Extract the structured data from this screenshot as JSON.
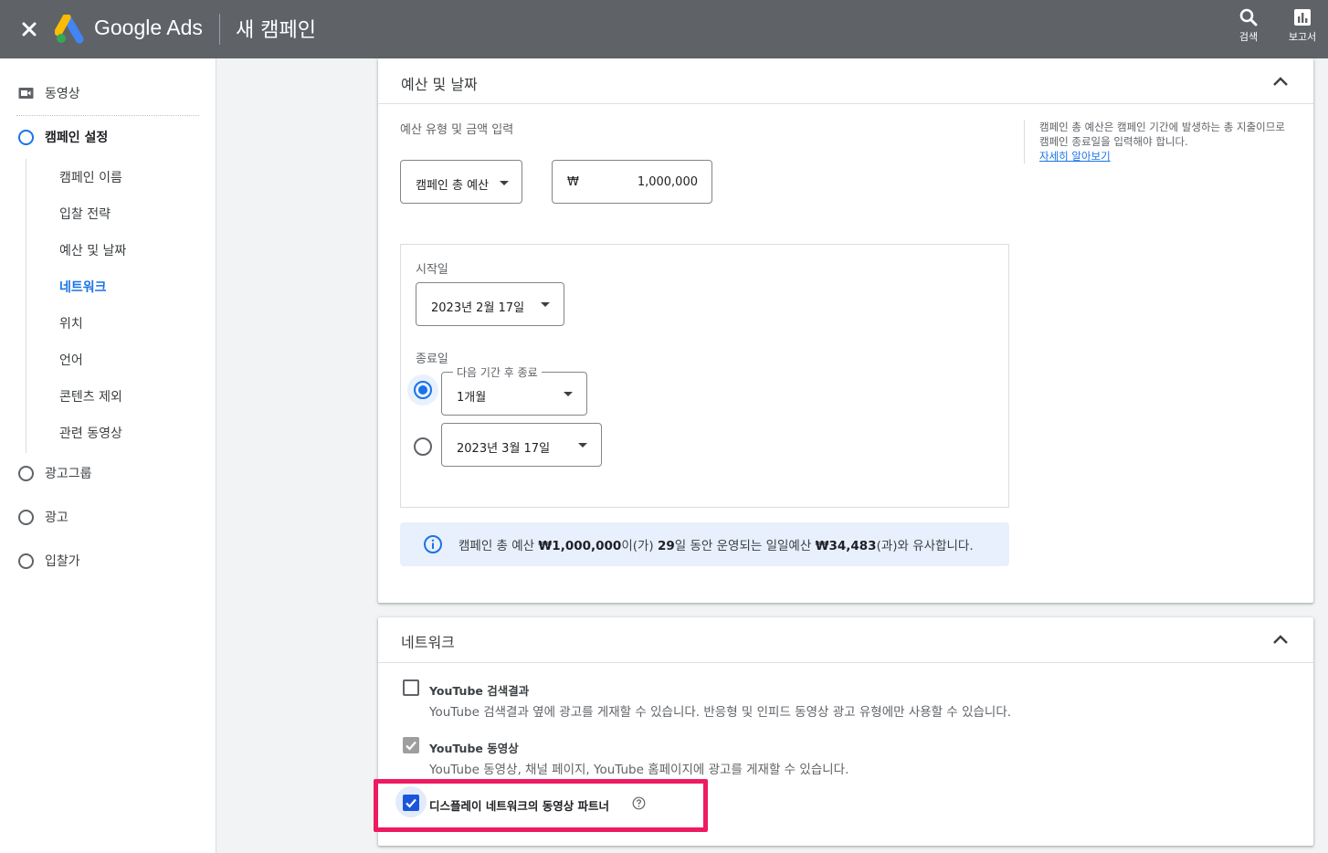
{
  "header": {
    "brand": "Google Ads",
    "title": "새 캠페인",
    "actions": [
      {
        "label": "검색",
        "icon": "search-icon"
      },
      {
        "label": "보고서",
        "icon": "reports-icon"
      }
    ]
  },
  "sidebar": {
    "video_label": "동영상",
    "campaign_settings": "캠페인 설정",
    "sub_items": [
      "캠페인 이름",
      "입찰 전략",
      "예산 및 날짜",
      "네트워크",
      "위치",
      "언어",
      "콘텐츠 제외",
      "관련 동영상"
    ],
    "current_sub_item": "네트워크",
    "steps": [
      "광고그룹",
      "광고",
      "입찰가"
    ]
  },
  "budget_card": {
    "title": "예산 및 날짜",
    "budget_label": "예산 유형 및 금액 입력",
    "budget_type": "캠페인 총 예산",
    "currency_symbol": "₩",
    "amount": "1,000,000",
    "help_text": "캠페인 총 예산은 캠페인 기간에 발생하는 총 지출이므로 캠페인 종료일을 입력해야 합니다.",
    "help_link": "자세히 알아보기",
    "start_label": "시작일",
    "start_date": "2023년 2월 17일",
    "end_label": "종료일",
    "end_option_floating_label": "다음 기간 후 종료",
    "end_duration": "1개월",
    "end_date": "2023년 3월 17일",
    "info": {
      "p1": "캠페인 총 예산 ",
      "b1": "₩1,000,000",
      "p2": "이(가) ",
      "b2": "29",
      "p3": "일 동안 운영되는 일일예산 ",
      "b3": "₩34,483",
      "p4": "(과)와 유사합니다."
    }
  },
  "network_card": {
    "title": "네트워크",
    "options": [
      {
        "title": "YouTube 검색결과",
        "desc": "YouTube 검색결과 옆에 광고를 게재할 수 있습니다. 반응형 및 인피드 동영상 광고 유형에만 사용할 수 있습니다.",
        "state": "unchecked"
      },
      {
        "title": "YouTube 동영상",
        "desc": "YouTube 동영상, 채널 페이지, YouTube 홈페이지에 광고를 게재할 수 있습니다.",
        "state": "checked-disabled"
      },
      {
        "title": "디스플레이 네트워크의 동영상 파트너",
        "state": "checked"
      }
    ]
  },
  "colors": {
    "topbar": "#5f6368",
    "accent": "#1a73e8",
    "highlight": "#ee1a62"
  }
}
